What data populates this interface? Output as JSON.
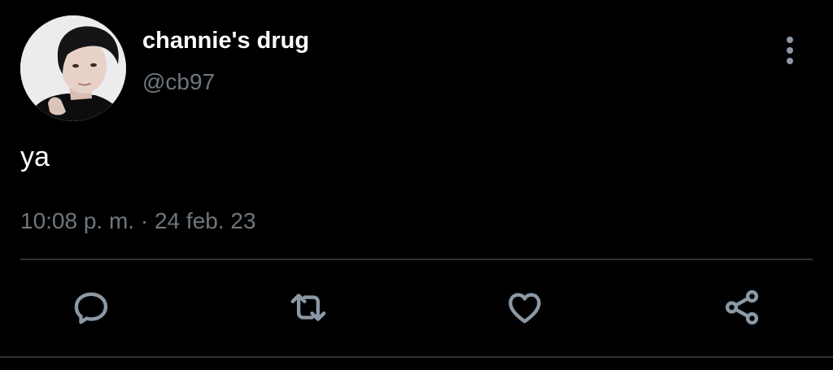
{
  "tweet": {
    "author": {
      "display_name": "channie's drug",
      "handle": "@cb97",
      "avatar_icon": "profile-photo"
    },
    "text": "ya",
    "time": "10:08 p. m.",
    "separator": "·",
    "date": "24 feb. 23"
  },
  "actions": {
    "more_icon": "more-vertical-icon",
    "reply_icon": "reply-icon",
    "retweet_icon": "retweet-icon",
    "like_icon": "heart-icon",
    "share_icon": "share-icon"
  },
  "colors": {
    "background": "#000000",
    "primary_text": "#ffffff",
    "secondary_text": "#6e767d",
    "icon": "#8b98a5",
    "divider": "#2f3336"
  }
}
